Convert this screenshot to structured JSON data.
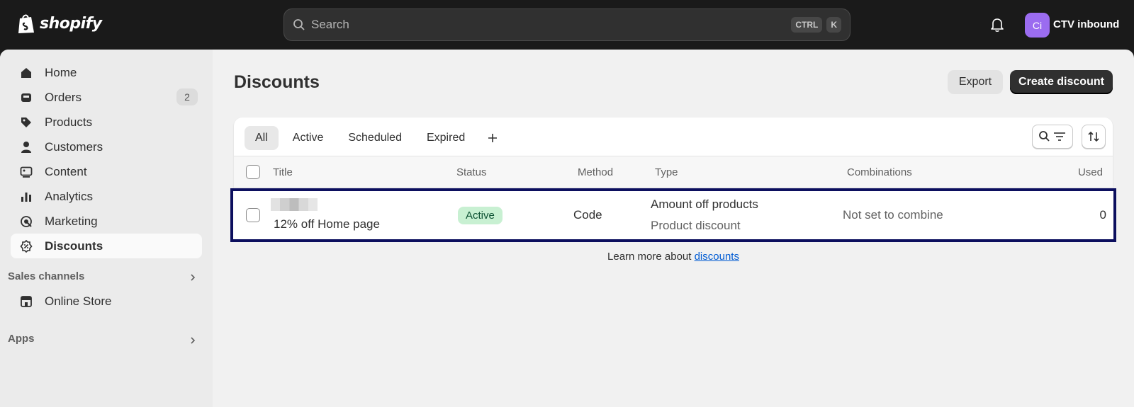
{
  "topbar": {
    "brand": "shopify",
    "search_placeholder": "Search",
    "shortcut_keys": [
      "CTRL",
      "K"
    ],
    "avatar_initials": "Ci",
    "store_name": "CTV inbound",
    "avatar_color": "#9b6cf0"
  },
  "sidebar": {
    "items": [
      {
        "label": "Home",
        "icon": "home-icon"
      },
      {
        "label": "Orders",
        "icon": "orders-icon",
        "badge": "2"
      },
      {
        "label": "Products",
        "icon": "tag-icon"
      },
      {
        "label": "Customers",
        "icon": "person-icon"
      },
      {
        "label": "Content",
        "icon": "content-icon"
      },
      {
        "label": "Analytics",
        "icon": "bar-chart-icon"
      },
      {
        "label": "Marketing",
        "icon": "target-icon"
      },
      {
        "label": "Discounts",
        "icon": "discount-icon",
        "active": true
      }
    ],
    "sales_channels_label": "Sales channels",
    "sales_channels": [
      {
        "label": "Online Store",
        "icon": "store-icon"
      }
    ],
    "apps_label": "Apps"
  },
  "page": {
    "title": "Discounts",
    "export_label": "Export",
    "create_label": "Create discount"
  },
  "tabs": [
    "All",
    "Active",
    "Scheduled",
    "Expired"
  ],
  "table": {
    "headers": {
      "title": "Title",
      "status": "Status",
      "method": "Method",
      "type": "Type",
      "combinations": "Combinations",
      "used": "Used"
    },
    "rows": [
      {
        "title": "12% off Home page",
        "status": "Active",
        "method": "Code",
        "type": "Amount off products",
        "type_sub": "Product discount",
        "combinations": "Not set to combine",
        "used": "0"
      }
    ]
  },
  "footer": {
    "learn_text": "Learn more about ",
    "learn_link": "discounts"
  },
  "colors": {
    "status_active_bg": "#c8f0d2",
    "highlight_border": "#0c0f5e",
    "link": "#005bd3"
  }
}
